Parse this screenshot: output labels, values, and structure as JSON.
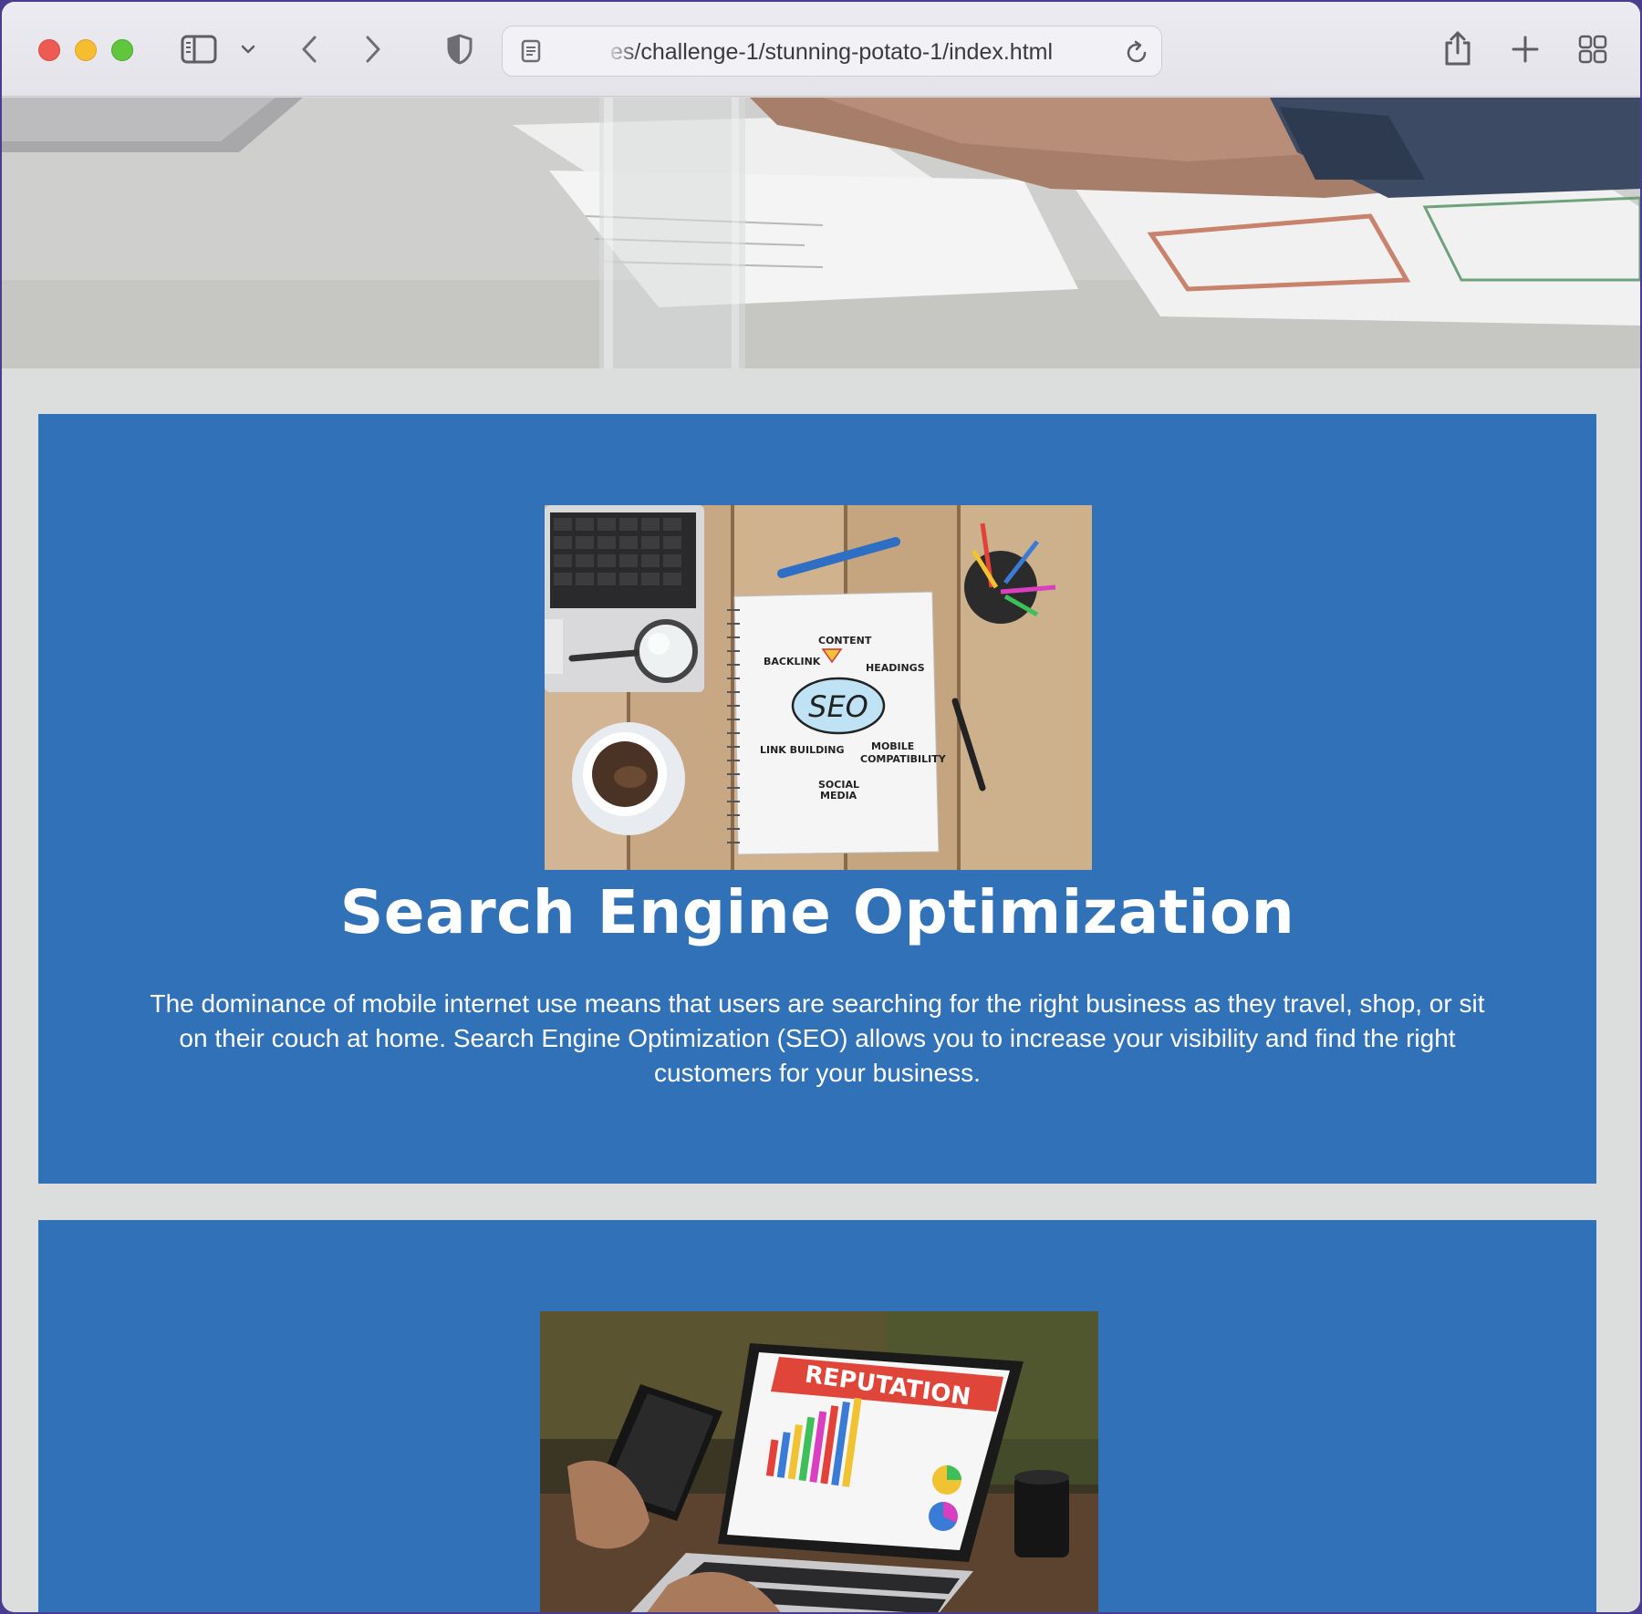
{
  "browser": {
    "url": "es/challenge-1/stunning-potato-1/index.html",
    "icons": {
      "close": "close-dot",
      "minimize": "minimize-dot",
      "zoom": "zoom-dot",
      "sidebar": "sidebar-icon",
      "sidebar_menu": "chevron-down-icon",
      "back": "back-arrow-icon",
      "forward": "forward-arrow-icon",
      "privacy": "shield-icon",
      "page": "page-icon",
      "reload": "reload-icon",
      "share": "share-icon",
      "new_tab": "plus-icon",
      "tab_overview": "tab-grid-icon"
    }
  },
  "sections": [
    {
      "title": "Search Engine Optimization",
      "body": "The dominance of mobile internet use means that users are searching for the right business as they travel, shop, or sit on their couch at home. Search Engine Optimization (SEO) allows you to increase your visibility and find the right customers for your business.",
      "image_labels": {
        "center": "SEO",
        "content": "CONTENT",
        "backlink": "BACKLINK",
        "headings": "HEADINGS",
        "link_building": "LINK BUILDING",
        "mobile": "MOBILE",
        "compatibility": "COMPATIBILITY",
        "social": "SOCIAL",
        "media": "MEDIA"
      }
    },
    {
      "image_labels": {
        "banner": "REPUTATION"
      }
    }
  ],
  "colors": {
    "card_bg": "#3171b7",
    "page_bg": "#dcdedd",
    "text": "#ffffff"
  }
}
